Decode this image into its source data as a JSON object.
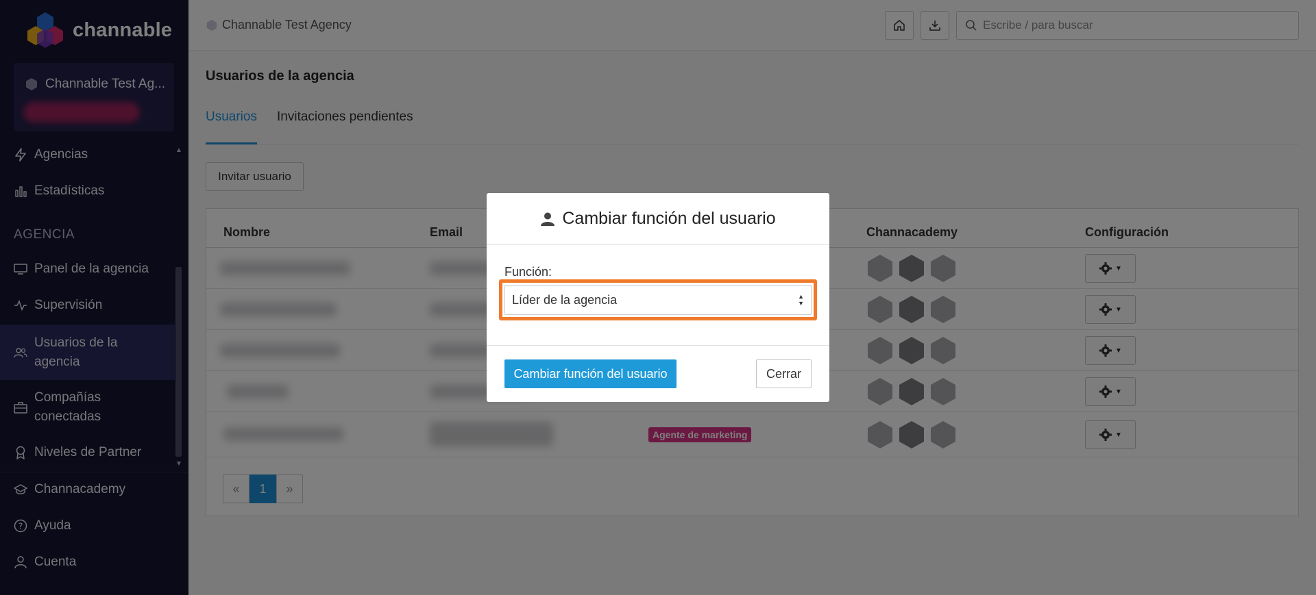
{
  "brand": {
    "name": "channable"
  },
  "account": {
    "name": "Channable Test Ag..."
  },
  "sidebar": {
    "items_top": [
      {
        "label": "Agencias",
        "icon": "bolt-icon"
      },
      {
        "label": "Estadísticas",
        "icon": "bar-chart-icon"
      }
    ],
    "section_label": "AGENCIA",
    "items_agency": [
      {
        "label": "Panel de la agencia",
        "icon": "monitor-icon"
      },
      {
        "label": "Supervisión",
        "icon": "activity-icon"
      },
      {
        "label": "Usuarios de la agencia",
        "icon": "users-icon",
        "active": true
      },
      {
        "label": "Compañías conectadas",
        "icon": "briefcase-icon"
      },
      {
        "label": "Niveles de Partner",
        "icon": "award-icon"
      }
    ],
    "items_bottom": [
      {
        "label": "Channacademy",
        "icon": "graduation-cap-icon"
      },
      {
        "label": "Ayuda",
        "icon": "help-circle-icon"
      },
      {
        "label": "Cuenta",
        "icon": "user-icon"
      }
    ]
  },
  "header": {
    "breadcrumb": "Channable Test Agency",
    "search_placeholder": "Escribe / para buscar"
  },
  "main": {
    "page_title": "Usuarios de la agencia",
    "tabs": [
      {
        "label": "Usuarios",
        "active": true
      },
      {
        "label": "Invitaciones pendientes",
        "active": false
      }
    ],
    "invite_button": "Invitar usuario",
    "table": {
      "columns": [
        "Nombre",
        "Email",
        "Channacademy",
        "Configuración"
      ],
      "badge": "Agente de marketing"
    },
    "pager": {
      "prev": "«",
      "current": "1",
      "next": "»"
    }
  },
  "modal": {
    "title": "Cambiar función del usuario",
    "field_label": "Función:",
    "selected_value": "Líder de la agencia",
    "submit": "Cambiar función del usuario",
    "close": "Cerrar"
  },
  "colors": {
    "sidebar_bg": "#161530",
    "accent": "#1e8fd6",
    "highlight": "#f07a2c",
    "badge": "#d63384"
  }
}
